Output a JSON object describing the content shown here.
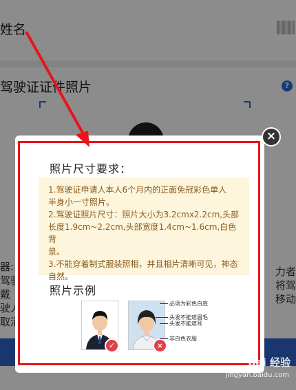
{
  "background": {
    "name_label": "姓名",
    "section_title": "驾驶证证件照片",
    "help_icon": "?",
    "left_fragments": [
      "器:",
      "驾驶",
      "戴",
      "驶人",
      "取消"
    ],
    "right_fragments": [
      "力者",
      "将驾",
      "移动"
    ]
  },
  "modal": {
    "close_icon": "×",
    "title": "照片尺寸要求：",
    "requirements": [
      "1.驾驶证申请人本人6个月内的正面免冠彩色单人",
      "半身小一寸照片。",
      "2.驾驶证照片尺寸：照片大小为3.2cmx2.2cm,头部",
      "长度1.9cm~2.2cm,头部宽度1.4cm~1.6cm,白色背",
      "景。",
      "3.不能穿着制式服装照相，并且相片清晰可见，神态",
      "自然。"
    ],
    "example_title": "照片示例",
    "annotations": [
      "必须为彩色白底",
      "头发不能遮眉毛",
      "头发不能遮耳",
      "非白色衣服"
    ],
    "ok_mark": "✓",
    "bad_mark": "×"
  },
  "colors": {
    "highlight": "#e8141b",
    "notice_bg": "#fdf6dc",
    "notice_text": "#8a5a1e",
    "primary": "#2e63c9"
  },
  "watermark": {
    "brand": "Bai 经验",
    "url": "jingyan.baidu.com"
  }
}
